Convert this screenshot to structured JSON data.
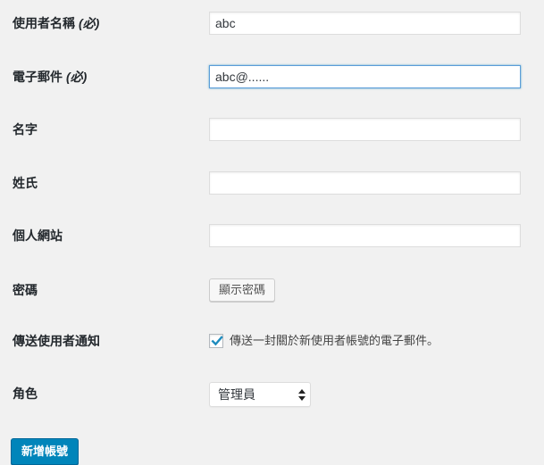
{
  "fields": {
    "username": {
      "label": "使用者名稱",
      "required_marker": "(必)",
      "value": "abc"
    },
    "email": {
      "label": "電子郵件",
      "required_marker": "(必)",
      "value": "abc@......"
    },
    "first_name": {
      "label": "名字",
      "value": ""
    },
    "last_name": {
      "label": "姓氏",
      "value": ""
    },
    "website": {
      "label": "個人網站",
      "value": ""
    },
    "password": {
      "label": "密碼",
      "button_label": "顯示密碼"
    },
    "send_notification": {
      "label": "傳送使用者通知",
      "checkbox_label": "傳送一封關於新使用者帳號的電子郵件。",
      "checked": true
    },
    "role": {
      "label": "角色",
      "selected": "管理員"
    }
  },
  "submit": {
    "label": "新增帳號"
  },
  "colors": {
    "primary_button": "#0085ba",
    "focus_border": "#5b9dd9",
    "checkmark": "#1e8cbe",
    "background": "#f1f1f1"
  }
}
